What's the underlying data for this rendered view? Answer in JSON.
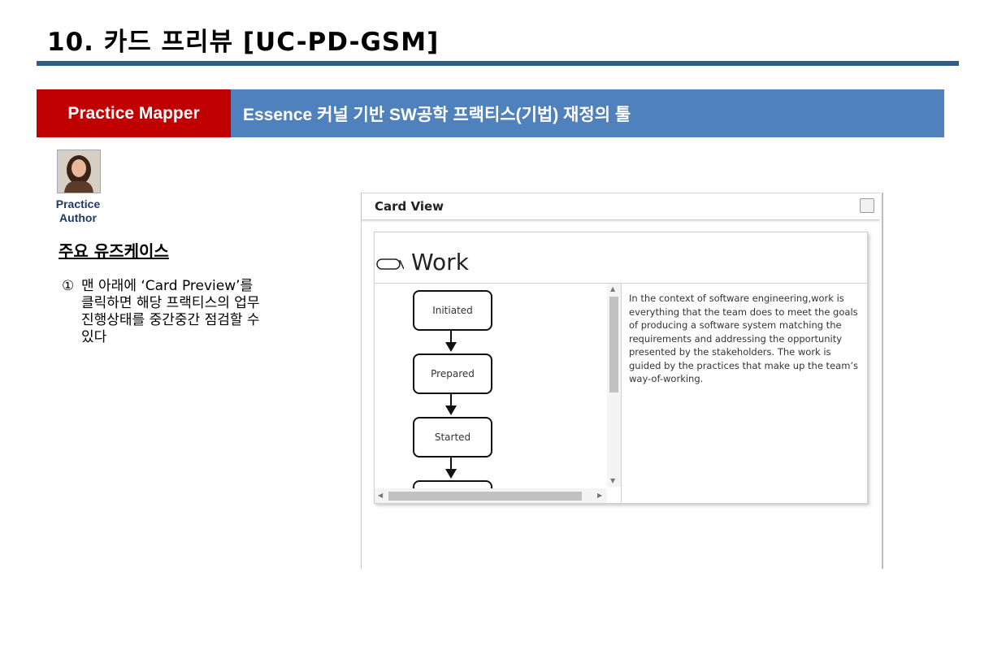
{
  "slide": {
    "title": "10. 카드 프리뷰 [UC-PD-GSM]"
  },
  "banner": {
    "app_name": "Practice Mapper",
    "subtitle": "Essence 커널 기반 SW공학 프랙티스(기법) 재정의 툴"
  },
  "author": {
    "label_line1": "Practice",
    "label_line2": "Author"
  },
  "use_cases": {
    "heading": "주요 유즈케이스",
    "items": [
      {
        "number": "①",
        "text": "맨 아래에 ‘Card Preview’를 클릭하면 해당 프랙티스의 업무 진행상태를 중간중간 점검할 수 있다"
      }
    ]
  },
  "card_view": {
    "title": "Card View",
    "card": {
      "title": "Work",
      "states": [
        "Initiated",
        "Prepared",
        "Started"
      ],
      "description": "In the context of software engineering,work is everything that the team does to meet the goals of producing a software system matching the requirements and addressing the opportunity presented by the stakeholders. The work is guided by the practices that make up the team’s way-of-working."
    }
  },
  "colors": {
    "banner_left": "#c00000",
    "banner_right": "#4f81bd",
    "title_rule": "#2f5a8c"
  },
  "icons": [
    "alpha-icon",
    "close-icon",
    "arrow-down-icon",
    "scroll-up-icon",
    "scroll-down-icon",
    "scroll-left-icon",
    "scroll-right-icon"
  ]
}
